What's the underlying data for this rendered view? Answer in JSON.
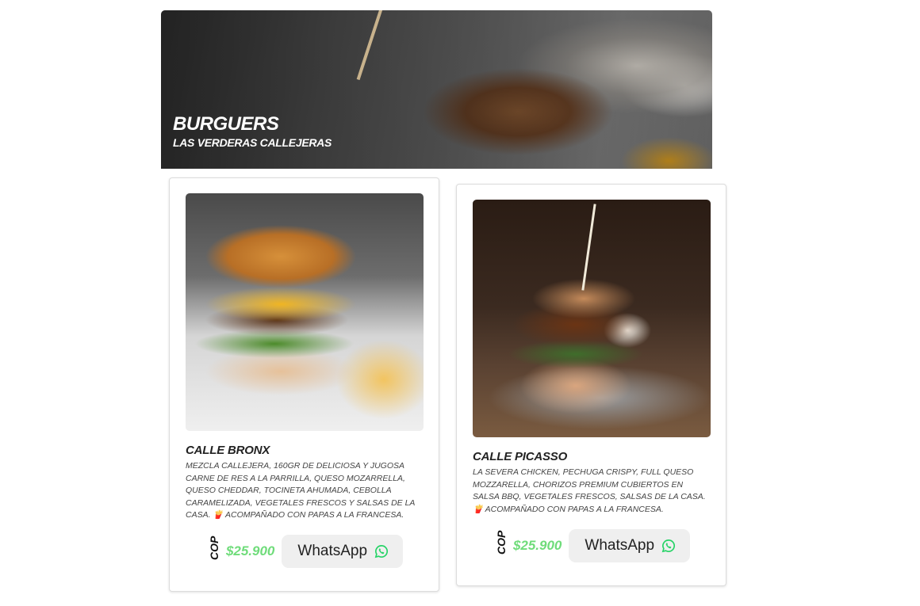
{
  "header": {
    "title": "BURGUERS",
    "subtitle": "LAS VERDERAS CALLEJERAS"
  },
  "items": [
    {
      "name": "CALLE BRONX",
      "description": "MEZCLA CALLEJERA, 160GR DE DELICIOSA Y JUGOSA CARNE DE RES A LA PARRILLA, QUESO MOZARRELLA, QUESO CHEDDAR, TOCINETA AHUMADA, CEBOLLA CARAMELIZADA, VEGETALES FRESCOS Y SALSAS DE LA CASA. 🍟 ACOMPAÑADO CON PAPAS A LA FRANCESA.",
      "currency": "COP",
      "price": "$25.900",
      "button_label": "WhatsApp"
    },
    {
      "name": "CALLE PICASSO",
      "description": "LA SEVERA CHICKEN, PECHUGA CRISPY, FULL QUESO MOZZARELLA, CHORIZOS PREMIUM CUBIERTOS EN SALSA BBQ, VEGETALES FRESCOS, SALSAS DE LA CASA. 🍟 ACOMPAÑADO CON PAPAS A LA FRANCESA.",
      "currency": "COP",
      "price": "$25.900",
      "button_label": "WhatsApp"
    }
  ],
  "colors": {
    "price": "#6fdc7a",
    "whatsapp_icon": "#25d366",
    "button_bg": "#efefef"
  },
  "icons": {
    "whatsapp": "whatsapp-icon"
  }
}
